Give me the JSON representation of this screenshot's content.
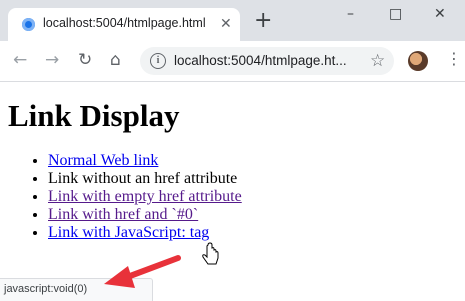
{
  "tab": {
    "title": "localhost:5004/htmlpage.html",
    "close_icon": "close-icon",
    "favicon": "favicon-icon"
  },
  "window": {
    "minimize": "–",
    "maximize": "□",
    "close": "✕"
  },
  "toolbar": {
    "url": "localhost:5004/htmlpage.ht...",
    "profile": "avatar"
  },
  "page": {
    "heading": "Link Display",
    "items": [
      {
        "text": "Normal Web link",
        "type": "link"
      },
      {
        "text": "Link without an href attribute",
        "type": "text"
      },
      {
        "text": "Link with empty href attribute",
        "type": "visited-link"
      },
      {
        "text": "Link with href and `#0`",
        "type": "visited-link"
      },
      {
        "text": "Link with JavaScript: tag",
        "type": "link"
      }
    ]
  },
  "status_bar": {
    "text": "javascript:void(0)"
  },
  "colors": {
    "link": "#0000ee",
    "visited": "#551a8b",
    "arrow": "#e8323a"
  }
}
